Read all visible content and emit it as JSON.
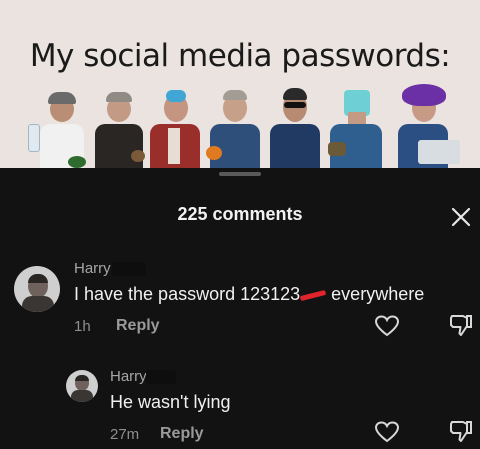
{
  "meme": {
    "title": "My social media passwords:"
  },
  "sheet": {
    "title": "225 comments",
    "close_icon": "close-icon"
  },
  "comments": [
    {
      "user": "Harry H",
      "text": "I have the password 123123",
      "text_after": " everywhere",
      "time": "1h",
      "reply_label": "Reply",
      "icons": [
        "heart-icon",
        "dislike-icon"
      ]
    },
    {
      "user": "Harry H",
      "text": "He wasn't lying",
      "time": "27m",
      "reply_label": "Reply",
      "icons": [
        "heart-icon",
        "dislike-icon"
      ]
    }
  ],
  "colors": {
    "sheet_bg": "#121212",
    "meme_bg": "#eae3e0",
    "redaction_mark": "#e0242e"
  }
}
